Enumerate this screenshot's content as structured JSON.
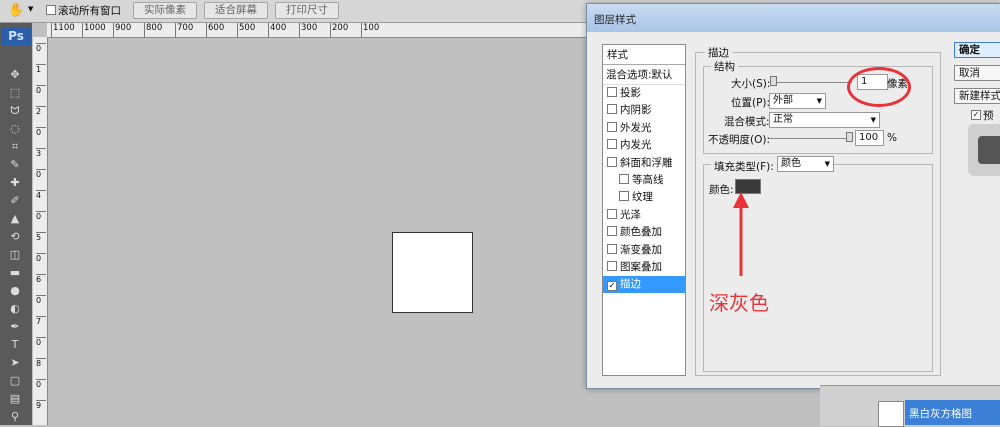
{
  "optionsbar": {
    "scroll_all_label": "滚动所有窗口",
    "actual_pixels": "实际像素",
    "fit_screen": "适合屏幕",
    "print_size": "打印尺寸",
    "ruler_ticks": [
      "1100",
      "1000",
      "900",
      "800",
      "700",
      "600",
      "500",
      "400",
      "300",
      "200",
      "100"
    ],
    "vruler_ticks": [
      "0",
      "1",
      "0",
      "2",
      "0",
      "3",
      "0",
      "4",
      "0",
      "5",
      "0",
      "6",
      "0",
      "7",
      "0",
      "8",
      "0",
      "9"
    ]
  },
  "toolbox": {
    "logo": "Ps",
    "tools": [
      "move-tool-icon",
      "marquee-tool-icon",
      "lasso-tool-icon",
      "quick-select-icon",
      "crop-tool-icon",
      "eyedropper-icon",
      "healing-brush-icon",
      "brush-icon",
      "clone-stamp-icon",
      "history-brush-icon",
      "eraser-icon",
      "gradient-icon",
      "blur-icon",
      "dodge-icon",
      "pen-icon",
      "type-icon",
      "path-select-icon",
      "shape-icon",
      "notes-icon",
      "zoom-eyedropper-icon"
    ]
  },
  "dialog": {
    "title": "图层样式",
    "style_list_header": "样式",
    "blend_options": "混合选项:默认",
    "styles": [
      {
        "label": "投影",
        "checked": false,
        "indent": false
      },
      {
        "label": "内阴影",
        "checked": false,
        "indent": false
      },
      {
        "label": "外发光",
        "checked": false,
        "indent": false
      },
      {
        "label": "内发光",
        "checked": false,
        "indent": false
      },
      {
        "label": "斜面和浮雕",
        "checked": false,
        "indent": false
      },
      {
        "label": "等高线",
        "checked": false,
        "indent": true
      },
      {
        "label": "纹理",
        "checked": false,
        "indent": true
      },
      {
        "label": "光泽",
        "checked": false,
        "indent": false
      },
      {
        "label": "颜色叠加",
        "checked": false,
        "indent": false
      },
      {
        "label": "渐变叠加",
        "checked": false,
        "indent": false
      },
      {
        "label": "图案叠加",
        "checked": false,
        "indent": false
      },
      {
        "label": "描边",
        "checked": true,
        "indent": false
      }
    ],
    "stroke_group": "描边",
    "structure_group": "结构",
    "size_label": "大小(S):",
    "size_value": "1",
    "size_unit": "像素",
    "position_label": "位置(P):",
    "position_value": "外部",
    "blend_label": "混合模式:",
    "blend_value": "正常",
    "opacity_label": "不透明度(O):",
    "opacity_value": "100",
    "opacity_unit": "%",
    "fill_type_label": "填充类型(F):",
    "fill_type_value": "颜色",
    "color_label": "颜色:",
    "stroke_color": "#3a3a3a",
    "annotation_text": "深灰色",
    "annotation_color": "#e8333a",
    "buttons": {
      "ok": "确定",
      "cancel": "取消",
      "new_style": "新建样式",
      "preview": "预览"
    }
  },
  "layers": {
    "selected_layer": "黑白灰方格图"
  }
}
